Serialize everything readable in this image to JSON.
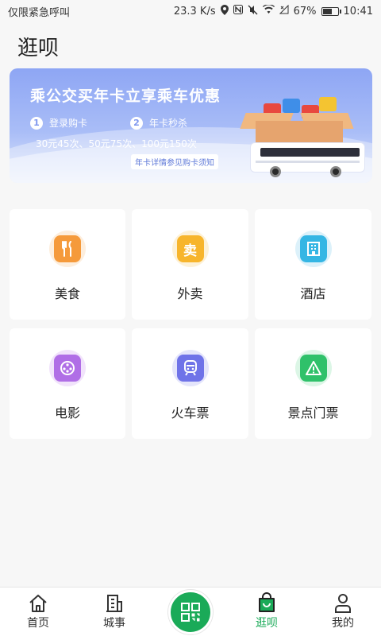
{
  "status_bar": {
    "left_text": "仅限紧急呼叫",
    "network_speed": "23.3 K/s",
    "battery_percent": "67%",
    "battery_level": 0.67,
    "time": "10:41"
  },
  "page": {
    "title": "逛呗"
  },
  "banner": {
    "title": "乘公交买年卡立享乘车优惠",
    "steps": [
      {
        "num": "1",
        "label": "登录购卡"
      },
      {
        "num": "2",
        "label": "年卡秒杀"
      }
    ],
    "prices": "30元45次、50元75次、100元150次",
    "notice": "年卡详情参见购卡须知"
  },
  "services": [
    {
      "label": "美食",
      "icon": "food-icon",
      "color": "#f59a3b",
      "halo": "#fdeedd"
    },
    {
      "label": "外卖",
      "icon": "takeout-icon",
      "color": "#f7b52c",
      "halo": "#fdf1d6",
      "glyph": "卖"
    },
    {
      "label": "酒店",
      "icon": "hotel-icon",
      "color": "#35b6e4",
      "halo": "#dcf1fa"
    },
    {
      "label": "电影",
      "icon": "movie-icon",
      "color": "#b06ee6",
      "halo": "#f1e3fb"
    },
    {
      "label": "火车票",
      "icon": "train-icon",
      "color": "#6f73e8",
      "halo": "#e4e5fb"
    },
    {
      "label": "景点门票",
      "icon": "scenic-icon",
      "color": "#2fc16a",
      "halo": "#dcf6e6"
    }
  ],
  "tabbar": {
    "items": [
      {
        "label": "首页",
        "icon": "home-icon"
      },
      {
        "label": "城事",
        "icon": "city-icon"
      },
      {
        "label": "逛呗",
        "icon": "shopping-bag-icon",
        "active": true
      },
      {
        "label": "我的",
        "icon": "profile-icon"
      }
    ],
    "center_icon": "qr-scan-icon",
    "accent_color": "#1aaa58"
  }
}
